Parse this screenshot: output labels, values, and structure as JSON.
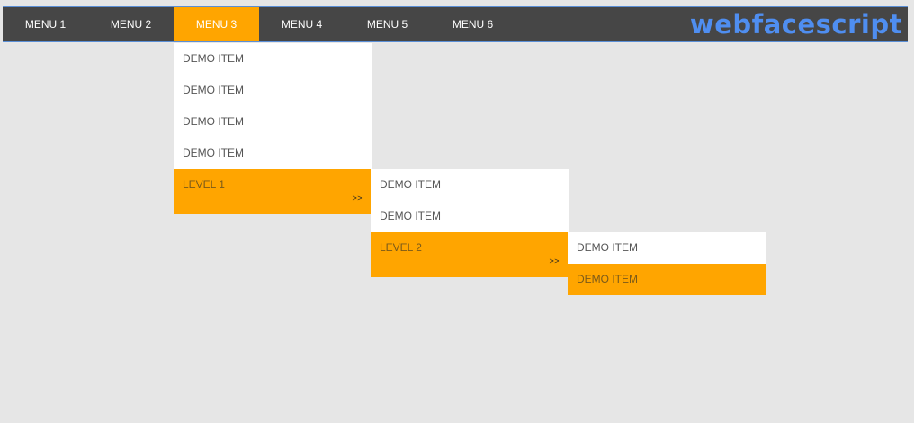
{
  "navbar": {
    "items": [
      {
        "label": "MENU 1"
      },
      {
        "label": "MENU 2"
      },
      {
        "label": "MENU 3"
      },
      {
        "label": "MENU 4"
      },
      {
        "label": "MENU 5"
      },
      {
        "label": "MENU 6"
      }
    ],
    "active_item": "MENU 3",
    "logo_text": "webfacescript"
  },
  "dropdown_level0": {
    "items": [
      {
        "label": "DEMO ITEM"
      },
      {
        "label": "DEMO ITEM"
      },
      {
        "label": "DEMO ITEM"
      },
      {
        "label": "DEMO ITEM"
      },
      {
        "label": "LEVEL 1",
        "arrow": ">>"
      }
    ]
  },
  "dropdown_level1": {
    "items": [
      {
        "label": "DEMO ITEM"
      },
      {
        "label": "DEMO ITEM"
      },
      {
        "label": "LEVEL 2",
        "arrow": ">>"
      }
    ]
  },
  "dropdown_level2": {
    "items": [
      {
        "label": "DEMO ITEM"
      },
      {
        "label": "DEMO ITEM"
      }
    ]
  },
  "colors": {
    "navbar_bg": "#464646",
    "accent": "#ffa500",
    "logo": "#4f8ef0",
    "page_bg": "#e6e6e6"
  }
}
